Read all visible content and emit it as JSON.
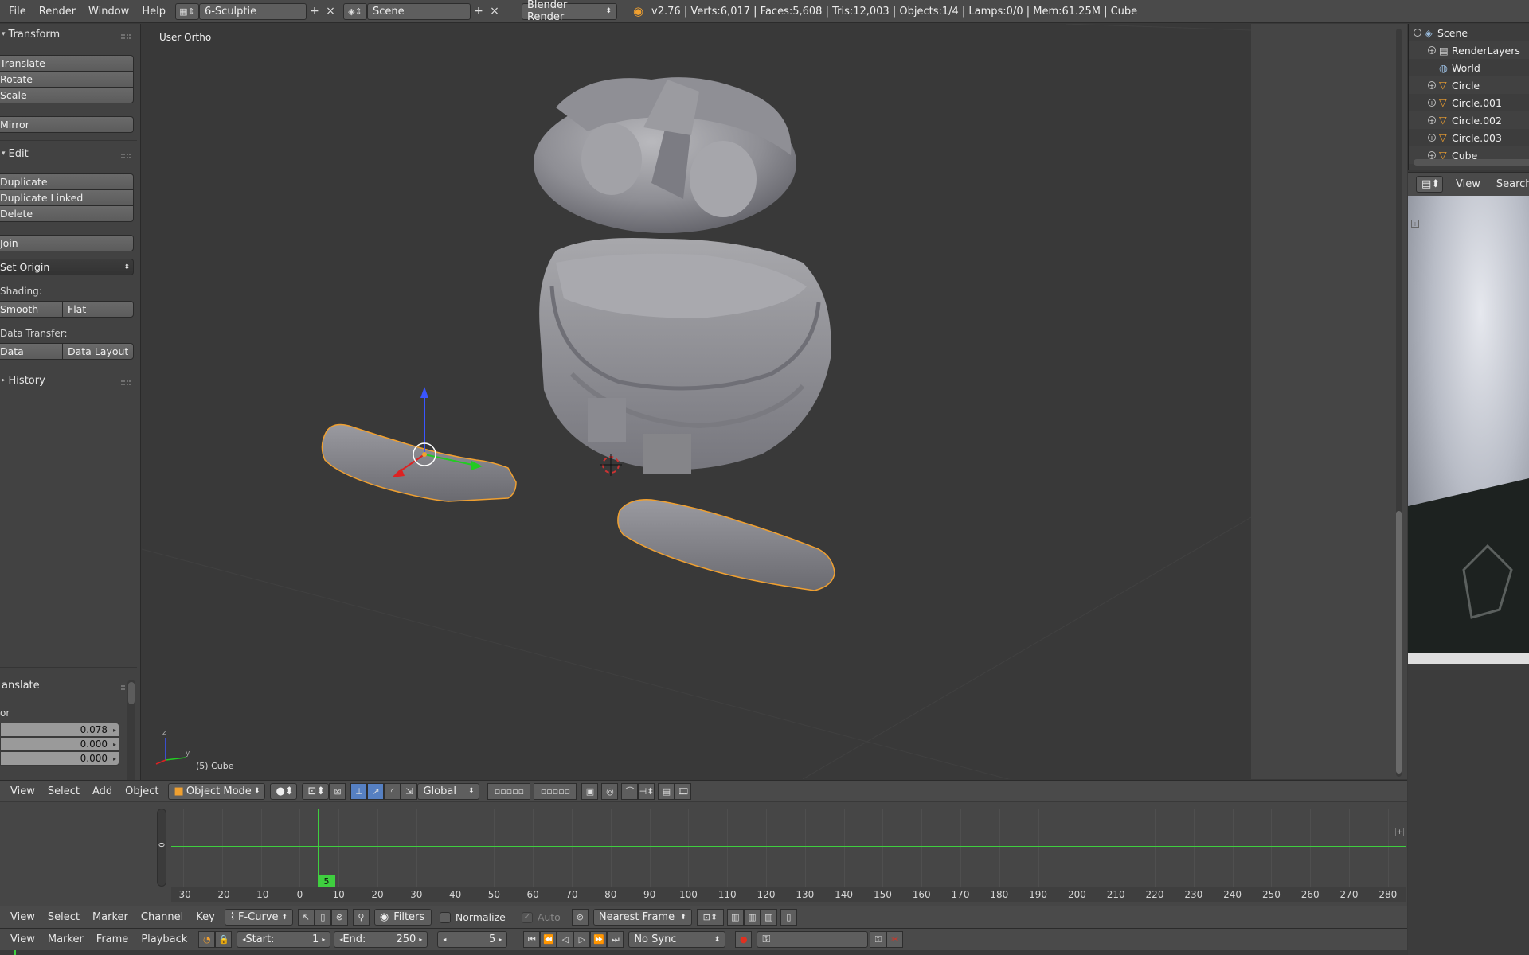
{
  "topbar": {
    "menus": [
      "File",
      "Render",
      "Window",
      "Help"
    ],
    "screen_layout": "6-Sculptie",
    "scene": "Scene",
    "engine": "Blender Render",
    "stats": "v2.76 | Verts:6,017 | Faces:5,608 | Tris:12,003 | Objects:1/4 | Lamps:0/0 | Mem:61.25M | Cube"
  },
  "toolshelf": {
    "transform_title": "Transform",
    "translate": "Translate",
    "rotate": "Rotate",
    "scale": "Scale",
    "mirror": "Mirror",
    "edit_title": "Edit",
    "duplicate": "Duplicate",
    "duplicate_linked": "Duplicate Linked",
    "delete": "Delete",
    "join": "Join",
    "set_origin": "Set Origin",
    "shading_label": "Shading:",
    "smooth": "Smooth",
    "flat": "Flat",
    "data_transfer_label": "Data Transfer:",
    "data": "Data",
    "data_layout": "Data Layout",
    "history_title": "History",
    "operator_title": "anslate",
    "vector_label": "or",
    "vector": [
      "0.078",
      "0.000",
      "0.000"
    ]
  },
  "viewport": {
    "view_label": "User Ortho",
    "object_label": "(5) Cube",
    "axis_z": "z",
    "axis_y": "y"
  },
  "viewport_header": {
    "menus": [
      "View",
      "Select",
      "Add",
      "Object"
    ],
    "mode": "Object Mode",
    "orientation": "Global"
  },
  "timeline_graph": {
    "ticks": [
      "-30",
      "-20",
      "-10",
      "0",
      "10",
      "20",
      "30",
      "40",
      "50",
      "60",
      "70",
      "80",
      "90",
      "100",
      "110",
      "120",
      "130",
      "140",
      "150",
      "160",
      "170",
      "180",
      "190",
      "200",
      "210",
      "220",
      "230",
      "240",
      "250",
      "260",
      "270",
      "280"
    ],
    "current_frame_badge": "5",
    "side_zero": "0"
  },
  "graph_header": {
    "menus": [
      "View",
      "Select",
      "Marker",
      "Channel",
      "Key"
    ],
    "mode": "F-Curve",
    "filters": "Filters",
    "normalize": "Normalize",
    "auto": "Auto",
    "snap": "Nearest Frame"
  },
  "timeline_header": {
    "menus": [
      "View",
      "Marker",
      "Frame",
      "Playback"
    ],
    "start_label": "Start:",
    "start_value": "1",
    "end_label": "End:",
    "end_value": "250",
    "current": "5",
    "sync": "No Sync"
  },
  "outliner": {
    "items": [
      "Scene",
      "RenderLayers",
      "World",
      "Circle",
      "Circle.001",
      "Circle.002",
      "Circle.003",
      "Cube"
    ]
  },
  "image_header": {
    "view": "View",
    "search": "Search"
  },
  "colors": {
    "accent_blue": "#5680c2",
    "selection_orange": "#f0a030",
    "timeline_green": "#3fcf3f"
  }
}
